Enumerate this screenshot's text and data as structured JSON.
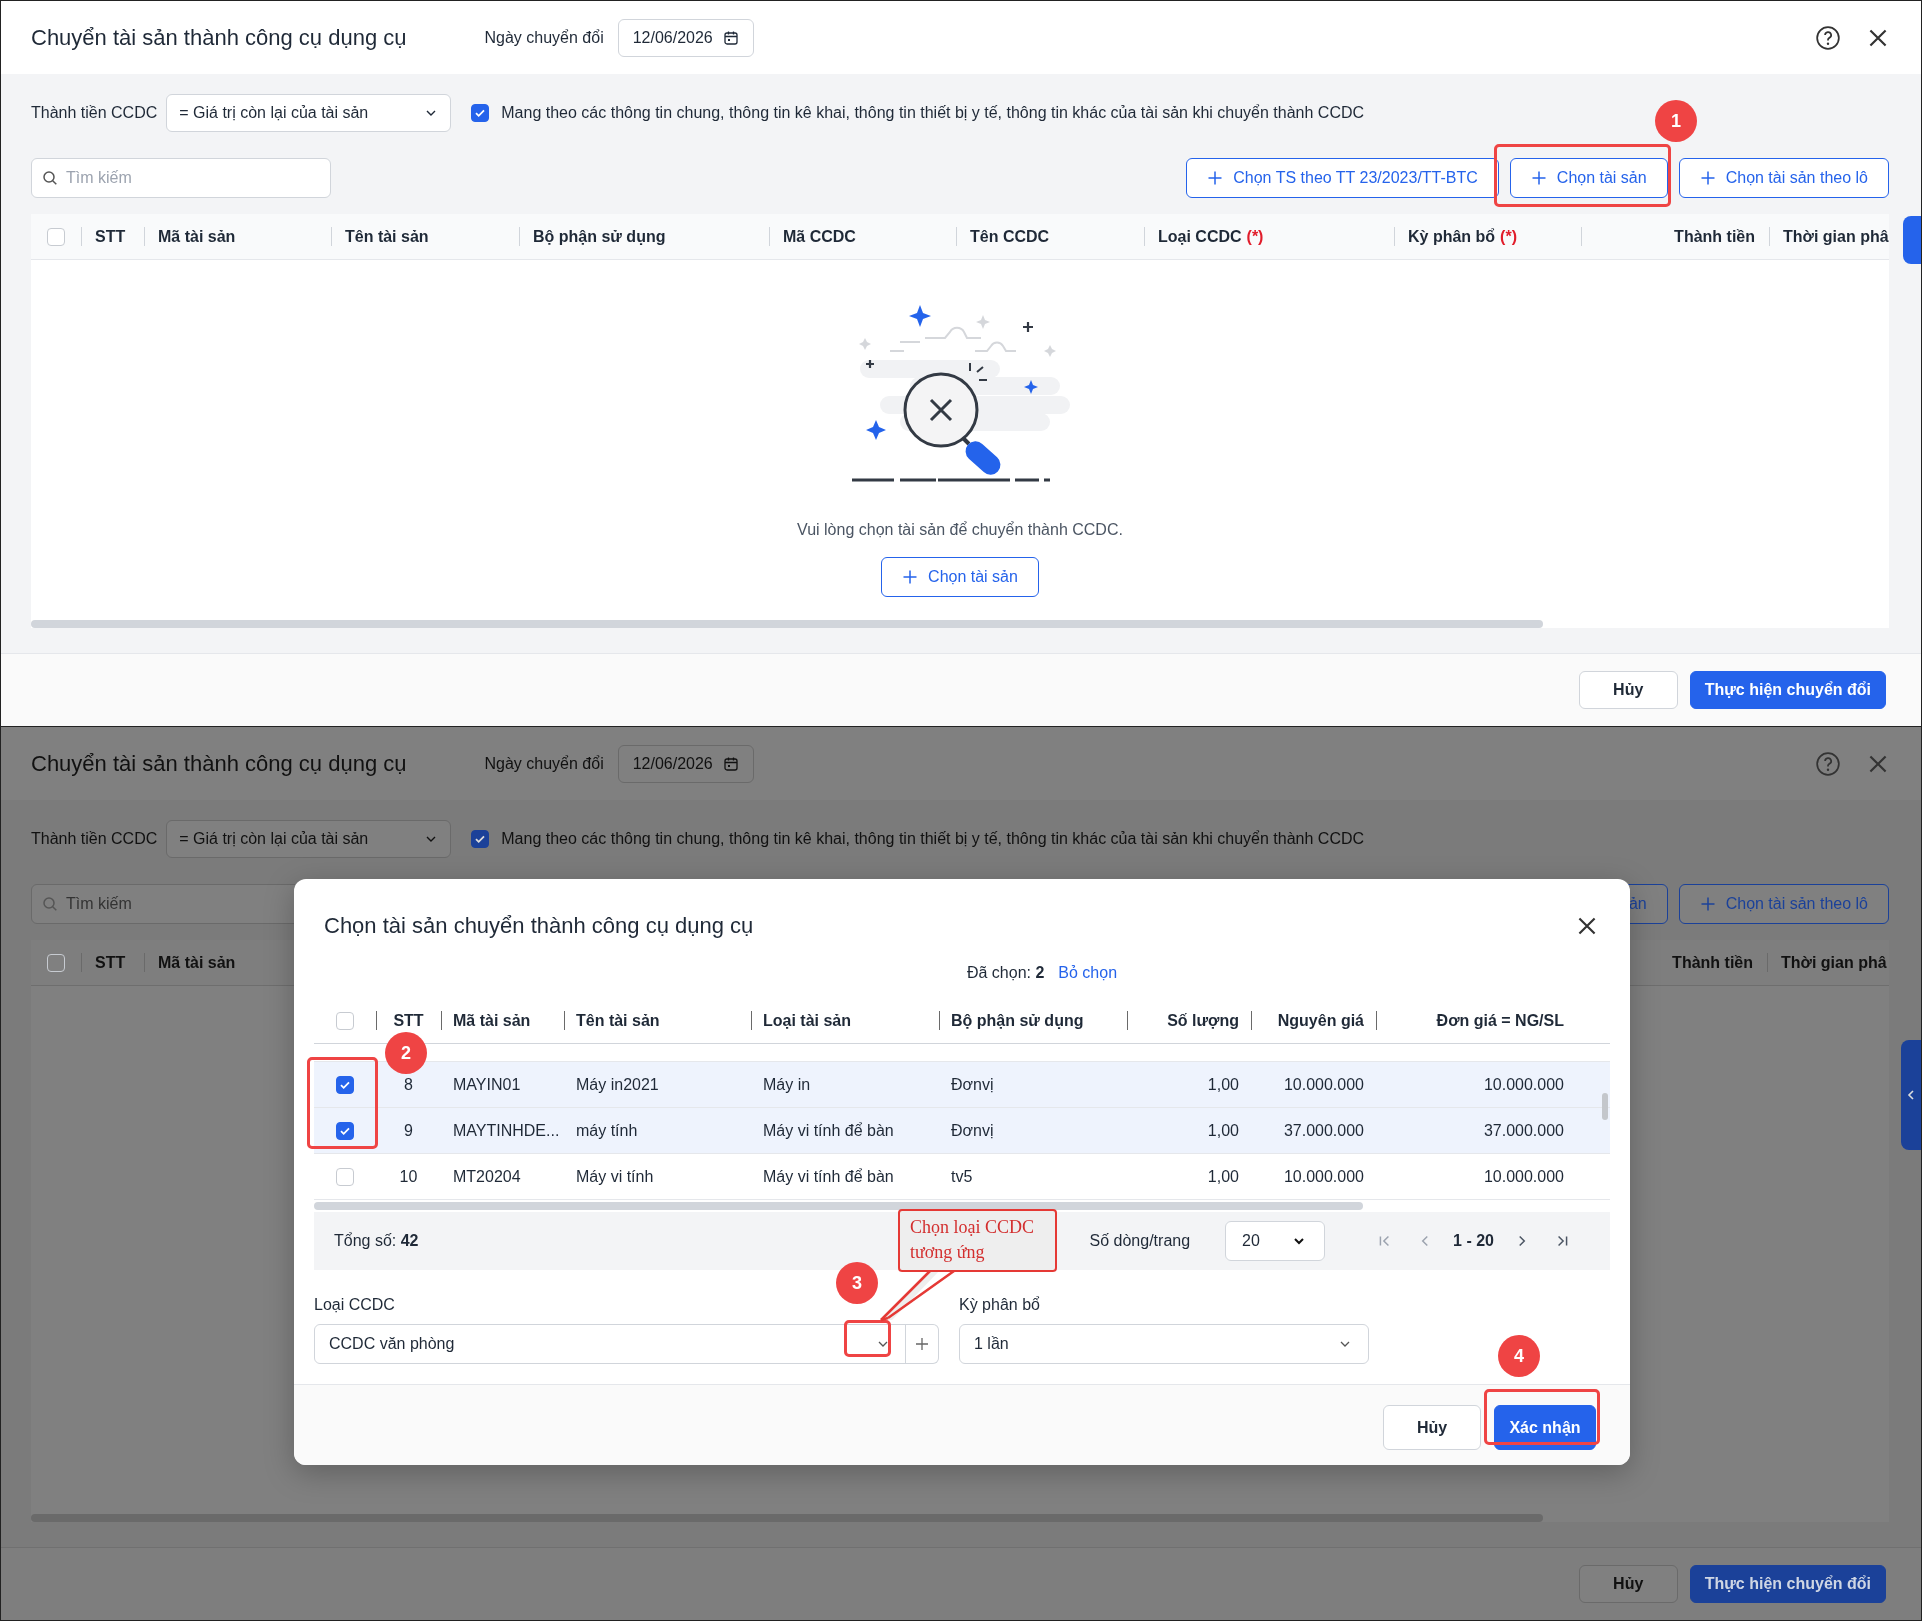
{
  "main_screen": {
    "title": "Chuyển tài sản thành công cụ dụng cụ",
    "date_label": "Ngày chuyển đổi",
    "date_value": "12/06/2026",
    "amount_label": "Thành tiền CCDC",
    "amount_value": "= Giá trị còn lại của tài sản",
    "carry_info": {
      "checked": true,
      "label": "Mang theo các thông tin chung, thông tin kê khai, thông tin thiết bị y tế, thông tin khác của tài sản khi chuyển thành CCDC"
    },
    "search": {
      "placeholder": "Tìm kiếm"
    },
    "actions": [
      {
        "label": "Chọn TS theo TT 23/2023/TT-BTC"
      },
      {
        "label": "Chọn tài sản"
      },
      {
        "label": "Chọn tài sản theo lô"
      }
    ],
    "table": {
      "select_all_checked": false,
      "columns": [
        {
          "label": "STT"
        },
        {
          "label": "Mã tài sản"
        },
        {
          "label": "Tên tài sản"
        },
        {
          "label": "Bộ phận sử dụng"
        },
        {
          "label": "Mã CCDC"
        },
        {
          "label": "Tên CCDC"
        },
        {
          "label": "Loại CCDC",
          "required_mark": "(*)"
        },
        {
          "label": "Kỳ phân bổ",
          "required_mark": "(*)"
        },
        {
          "label": "Thành tiền"
        },
        {
          "label": "Thời gian phâ"
        }
      ]
    },
    "empty_state": {
      "message": "Vui lòng chọn tài sản để chuyển thành CCDC.",
      "button": "Chọn tài sản"
    },
    "footer_buttons": [
      {
        "label": "Hủy",
        "kind": "secondary"
      },
      {
        "label": "Thực hiện chuyển đổi",
        "kind": "primary"
      }
    ]
  },
  "dimmed_screen": {
    "title": "Chuyển tài sản thành công cụ dụng cụ",
    "date_label": "Ngày chuyển đổi",
    "date_value": "12/06/2026",
    "amount_label": "Thành tiền CCDC",
    "amount_value": "= Giá trị còn lại của tài sản",
    "carry_info": {
      "checked": true,
      "label": "Mang theo các thông tin chung, thông tin kê khai, thông tin thiết bị y tế, thông tin khác của tài sản khi chuyển thành CCDC"
    },
    "search": {
      "placeholder": "Tìm kiếm"
    },
    "actions": [
      {
        "label": "ản"
      },
      {
        "label": "Chọn tài sản theo lô"
      }
    ],
    "table": {
      "select_all_checked": false,
      "columns": [
        {
          "label": "STT"
        },
        {
          "label": "Mã tài sản"
        },
        {
          "label": "Thành tiền"
        },
        {
          "label": "Thời gian phâ"
        }
      ]
    },
    "footer_buttons": [
      {
        "label": "Hủy",
        "kind": "secondary"
      },
      {
        "label": "Thực hiện chuyển đổi",
        "kind": "primary"
      }
    ]
  },
  "dialog": {
    "title": "Chọn tài sản chuyển thành công cụ dụng cụ",
    "selected_label": "Đã chọn:",
    "selected_count": "2",
    "clear_link": "Bỏ chọn",
    "table": {
      "select_all_checked": false,
      "columns": [
        {
          "label": "STT"
        },
        {
          "label": "Mã tài sản"
        },
        {
          "label": "Tên tài sản"
        },
        {
          "label": "Loại tài sản"
        },
        {
          "label": "Bộ phận sử dụng"
        },
        {
          "label": "Số lượng"
        },
        {
          "label": "Nguyên giá"
        },
        {
          "label": "Đơn giá = NG/SL"
        }
      ],
      "rows": [
        {
          "stt": "8",
          "code": "MAYIN01",
          "name": "Máy in2021",
          "type": "Máy in",
          "dept": "Đơnvị",
          "qty": "1,00",
          "cost": "10.000.000",
          "unit_price": "10.000.000",
          "selected": true
        },
        {
          "stt": "9",
          "code": "MAYTINHDE...",
          "name": "máy tính",
          "type": "Máy vi tính để bàn",
          "dept": "Đơnvị",
          "qty": "1,00",
          "cost": "37.000.000",
          "unit_price": "37.000.000",
          "selected": true
        },
        {
          "stt": "10",
          "code": "MT20204",
          "name": "Máy vi tính",
          "type": "Máy vi tính để bàn",
          "dept": "tv5",
          "qty": "1,00",
          "cost": "10.000.000",
          "unit_price": "10.000.000",
          "selected": false
        }
      ]
    },
    "total_label": "Tổng số:",
    "total_value": "42",
    "page_size_label": "Số dòng/trang",
    "page_size": "20",
    "page_range": "1 - 20",
    "fields": [
      {
        "label": "Loại CCDC",
        "value": "CCDC văn phòng"
      },
      {
        "label": "Kỳ phân bổ",
        "value": "1 lần"
      }
    ],
    "buttons": [
      {
        "label": "Hủy",
        "kind": "secondary"
      },
      {
        "label": "Xác nhận",
        "kind": "primary"
      }
    ]
  },
  "annotations": [
    {
      "number": "1"
    },
    {
      "number": "2"
    },
    {
      "number": "3"
    },
    {
      "number": "4"
    }
  ],
  "callout": {
    "text": "Chọn loại CCDC tương ứng"
  }
}
